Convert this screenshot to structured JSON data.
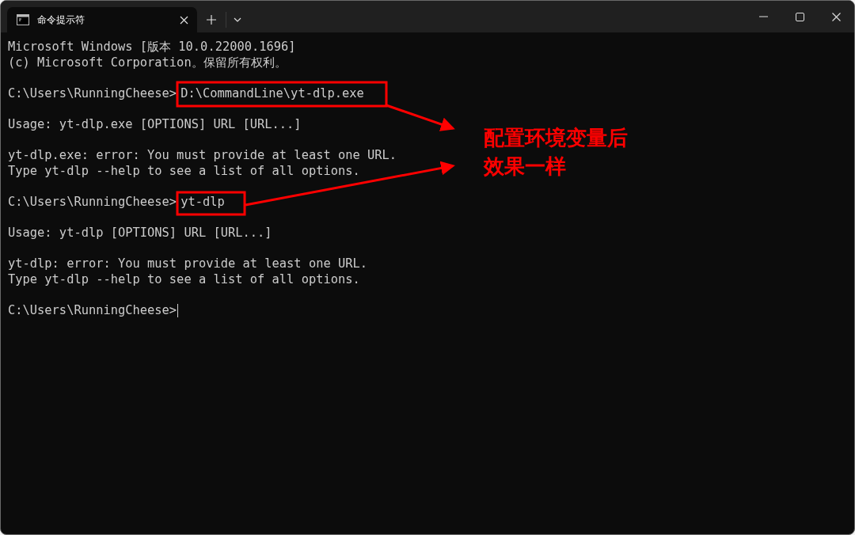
{
  "window": {
    "tab_title": "命令提示符"
  },
  "lines": [
    {
      "kind": "text",
      "text": "Microsoft Windows [版本 10.0.22000.1696]"
    },
    {
      "kind": "text",
      "text": "(c) Microsoft Corporation。保留所有权利。"
    },
    {
      "kind": "blank"
    },
    {
      "kind": "command",
      "prompt": "C:\\Users\\RunningCheese>",
      "command": "D:\\CommandLine\\yt-dlp.exe",
      "highlighted": true
    },
    {
      "kind": "blank"
    },
    {
      "kind": "text",
      "text": "Usage: yt-dlp.exe [OPTIONS] URL [URL...]"
    },
    {
      "kind": "blank"
    },
    {
      "kind": "text",
      "text": "yt-dlp.exe: error: You must provide at least one URL."
    },
    {
      "kind": "text",
      "text": "Type yt-dlp --help to see a list of all options."
    },
    {
      "kind": "blank"
    },
    {
      "kind": "command",
      "prompt": "C:\\Users\\RunningCheese>",
      "command": "yt-dlp",
      "highlighted": true
    },
    {
      "kind": "blank"
    },
    {
      "kind": "text",
      "text": "Usage: yt-dlp [OPTIONS] URL [URL...]"
    },
    {
      "kind": "blank"
    },
    {
      "kind": "text",
      "text": "yt-dlp: error: You must provide at least one URL."
    },
    {
      "kind": "text",
      "text": "Type yt-dlp --help to see a list of all options."
    },
    {
      "kind": "blank"
    },
    {
      "kind": "command",
      "prompt": "C:\\Users\\RunningCheese>",
      "cursor": true
    }
  ],
  "annotation": {
    "text": "配置环境变量后效果一样"
  }
}
